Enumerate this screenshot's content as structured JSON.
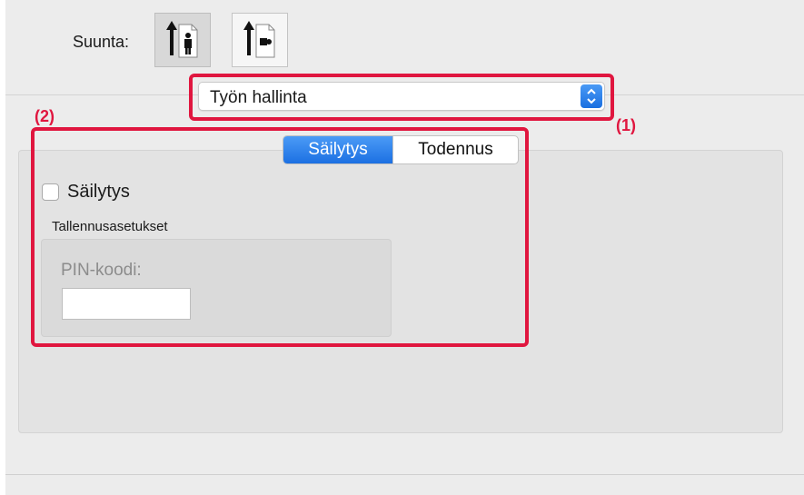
{
  "orientation": {
    "label": "Suunta:",
    "options": [
      {
        "name": "portrait",
        "selected": true
      },
      {
        "name": "landscape",
        "selected": false
      }
    ]
  },
  "job_menu": {
    "value": "Työn hallinta",
    "callout": "(1)"
  },
  "settings": {
    "callout": "(2)",
    "tabs": [
      "Säilytys",
      "Todennus"
    ],
    "active_tab": "Säilytys",
    "retention_checkbox": {
      "label": "Säilytys",
      "checked": false
    },
    "group_title": "Tallennusasetukset",
    "pin_label": "PIN-koodi:",
    "pin_value": ""
  },
  "colors": {
    "highlight": "#e0163f",
    "accent": "#1c70e2"
  }
}
